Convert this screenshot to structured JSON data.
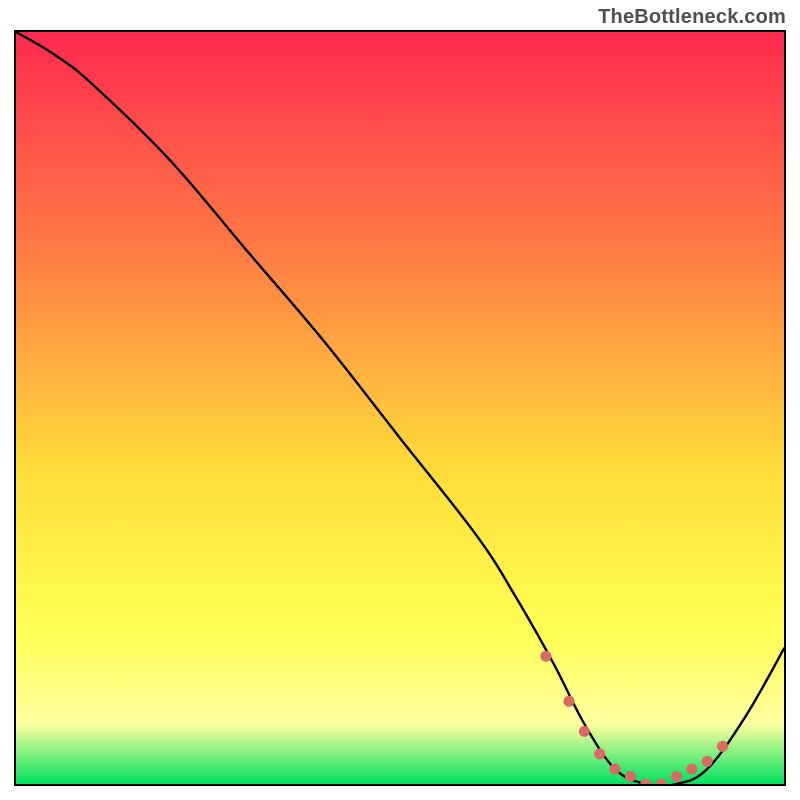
{
  "attribution": "TheBottleneck.com",
  "colors": {
    "gradient_top": "#ff2a4f",
    "gradient_mid1": "#ff7845",
    "gradient_mid2": "#ffdc3a",
    "gradient_mid3": "#ffff55",
    "gradient_mid4": "#ffffa0",
    "gradient_bottom": "#00e060",
    "curve": "#000000",
    "markers": "#d96a66",
    "frame": "#000000"
  },
  "chart_data": {
    "type": "line",
    "title": "",
    "xlabel": "",
    "ylabel": "",
    "xlim": [
      0,
      100
    ],
    "ylim": [
      0,
      100
    ],
    "grid": false,
    "legend": false,
    "series": [
      {
        "name": "curve",
        "x": [
          0,
          5,
          10,
          20,
          30,
          40,
          50,
          60,
          65,
          70,
          74,
          78,
          82,
          86,
          90,
          95,
          100
        ],
        "y": [
          100,
          97,
          93,
          83,
          71,
          59,
          46,
          33,
          25,
          16,
          8,
          2,
          0,
          0,
          2,
          9,
          18
        ]
      }
    ],
    "markers": {
      "name": "highlight-dots",
      "x": [
        69,
        72,
        74,
        76,
        78,
        80,
        82,
        84,
        86,
        88,
        90,
        92
      ],
      "y": [
        17,
        11,
        7,
        4,
        2,
        1,
        0,
        0,
        1,
        2,
        3,
        5
      ]
    }
  }
}
